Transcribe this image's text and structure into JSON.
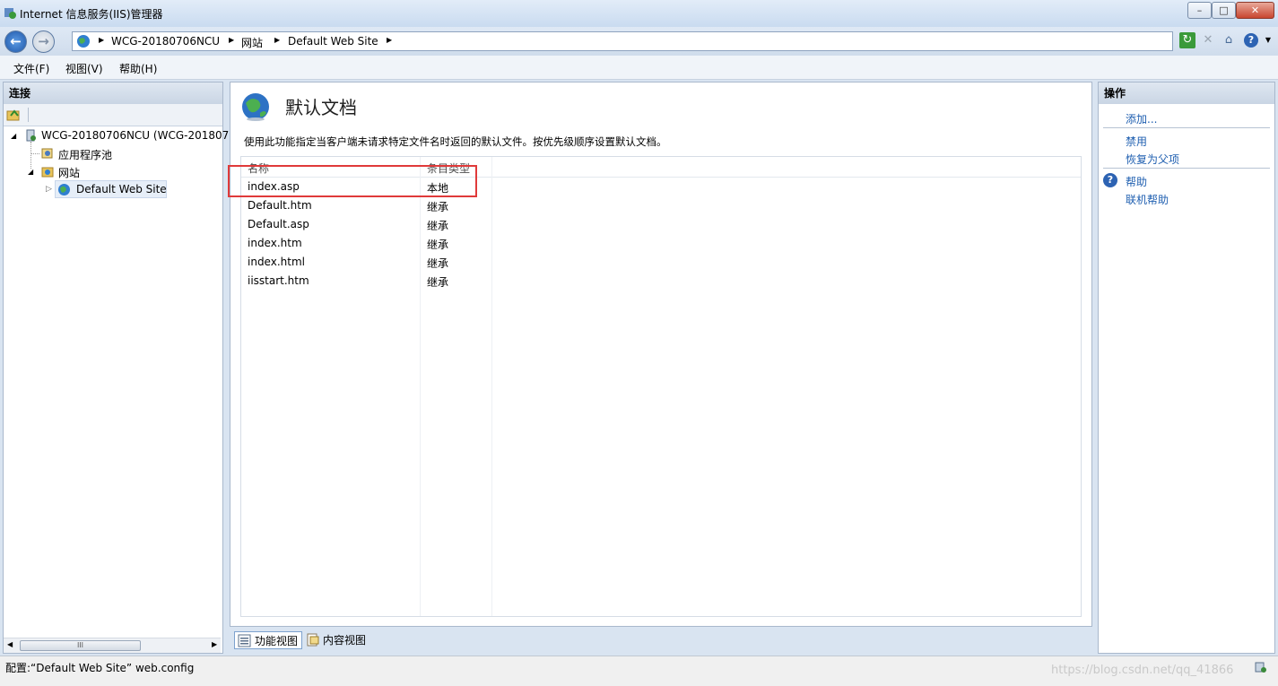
{
  "window": {
    "title": "Internet 信息服务(IIS)管理器",
    "controls": {
      "minimize": "–",
      "maximize": "□",
      "close": "✕"
    }
  },
  "address": {
    "crumbs": [
      "WCG-20180706NCU",
      "网站",
      "Default Web Site"
    ]
  },
  "menu": [
    "文件(F)",
    "视图(V)",
    "帮助(H)"
  ],
  "connections": {
    "header": "连接",
    "tree": {
      "server": "WCG-20180706NCU (WCG-2018070",
      "app_pools": "应用程序池",
      "sites": "网站",
      "default_site": "Default Web Site"
    },
    "scroll_thumb": "III"
  },
  "main": {
    "title": "默认文档",
    "description": "使用此功能指定当客户端未请求特定文件名时返回的默认文件。按优先级顺序设置默认文档。",
    "columns": [
      "名称",
      "条目类型"
    ],
    "rows": [
      {
        "name": "index.asp",
        "type": "本地"
      },
      {
        "name": "Default.htm",
        "type": "继承"
      },
      {
        "name": "Default.asp",
        "type": "继承"
      },
      {
        "name": "index.htm",
        "type": "继承"
      },
      {
        "name": "index.html",
        "type": "继承"
      },
      {
        "name": "iisstart.htm",
        "type": "继承"
      }
    ]
  },
  "view_tabs": {
    "feature_view": "功能视图",
    "content_view": "内容视图"
  },
  "actions": {
    "header": "操作",
    "add": "添加...",
    "disable": "禁用",
    "revert": "恢复为父项",
    "help": "帮助",
    "online_help": "联机帮助"
  },
  "status": {
    "text": "配置:“Default Web Site”  web.config",
    "watermark": "https://blog.csdn.net/qq_41866"
  },
  "colors": {
    "highlight_box": "#e03a3a",
    "link": "#1f5fb0"
  }
}
